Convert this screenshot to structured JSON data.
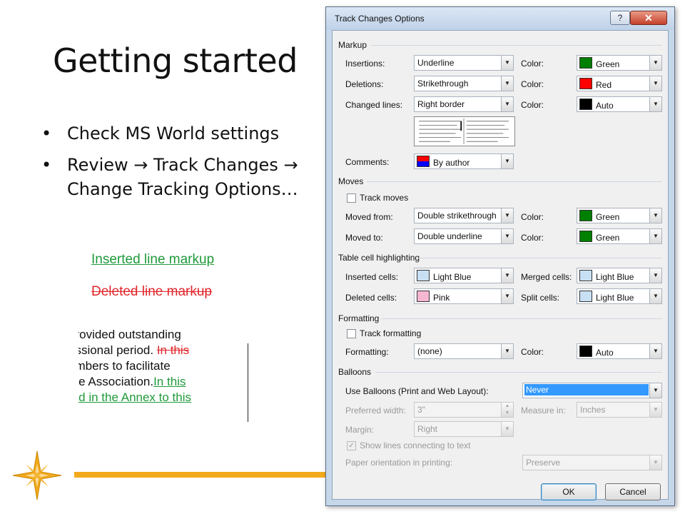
{
  "slide": {
    "title": "Getting started",
    "bullets": [
      "Check MS World settings",
      "Review → Track Changes → Change Tracking Options…"
    ],
    "sample_inserted": "Inserted line markup",
    "sample_deleted": "Deleted line markup",
    "doc_excerpt": {
      "line1": "provided outstanding",
      "line2a": "essional period. ",
      "line2b": "In this",
      "line3": "embers to facilitate",
      "line4a": "the Association.",
      "line4b": "In this",
      "line5": "ted in the Annex to this"
    }
  },
  "colors": {
    "green": "#008000",
    "red": "#ff0000",
    "auto": "#000000",
    "light_blue": "#c8e0f4",
    "pink": "#f7b6d2",
    "accent_gold": "#f2aa1c"
  },
  "dialog": {
    "title": "Track Changes Options",
    "help_label": "?",
    "close_label": "✕",
    "markup": {
      "section": "Markup",
      "insertions_label": "Insertions:",
      "insertions_value": "Underline",
      "deletions_label": "Deletions:",
      "deletions_value": "Strikethrough",
      "changed_lines_label": "Changed lines:",
      "changed_lines_value": "Right border",
      "comments_label": "Comments:",
      "comments_value": "By author",
      "color_label": "Color:",
      "insertions_color": "Green",
      "deletions_color": "Red",
      "changed_lines_color": "Auto"
    },
    "moves": {
      "section": "Moves",
      "track_moves": "Track moves",
      "moved_from_label": "Moved from:",
      "moved_from_value": "Double strikethrough",
      "moved_to_label": "Moved to:",
      "moved_to_value": "Double underline",
      "color_label": "Color:",
      "moved_from_color": "Green",
      "moved_to_color": "Green"
    },
    "table_cells": {
      "section": "Table cell highlighting",
      "inserted_label": "Inserted cells:",
      "inserted_value": "Light Blue",
      "deleted_label": "Deleted cells:",
      "deleted_value": "Pink",
      "merged_label": "Merged cells:",
      "merged_value": "Light Blue",
      "split_label": "Split cells:",
      "split_value": "Light Blue"
    },
    "formatting": {
      "section": "Formatting",
      "track_formatting": "Track formatting",
      "formatting_label": "Formatting:",
      "formatting_value": "(none)",
      "color_label": "Color:",
      "color_value": "Auto"
    },
    "balloons": {
      "section": "Balloons",
      "use_balloons_label": "Use Balloons (Print and Web Layout):",
      "use_balloons_value": "Never",
      "preferred_width_label": "Preferred width:",
      "preferred_width_value": "3\"",
      "measure_in_label": "Measure in:",
      "measure_in_value": "Inches",
      "margin_label": "Margin:",
      "margin_value": "Right",
      "show_lines": "Show lines connecting to text",
      "paper_orientation_label": "Paper orientation in printing:",
      "paper_orientation_value": "Preserve"
    },
    "ok_label": "OK",
    "cancel_label": "Cancel"
  }
}
